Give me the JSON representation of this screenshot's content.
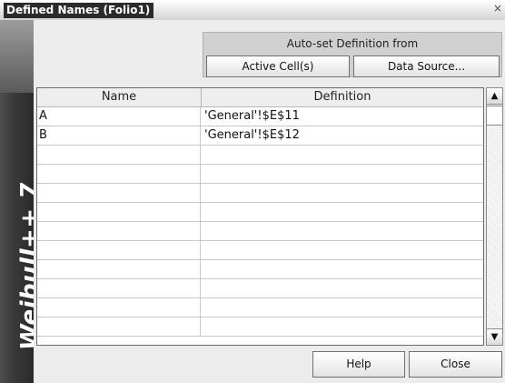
{
  "window": {
    "title": "Defined Names (Folio1)",
    "close_glyph": "×",
    "brand": "Weibull++ 7"
  },
  "autoset": {
    "label": "Auto-set Definition from",
    "active_cells_label": "Active Cell(s)",
    "data_source_label": "Data Source..."
  },
  "table": {
    "columns": [
      "Name",
      "Definition"
    ],
    "rows": [
      {
        "name": "A",
        "definition": "'General'!$E$11"
      },
      {
        "name": "B",
        "definition": "'General'!$E$12"
      },
      {
        "name": "",
        "definition": ""
      },
      {
        "name": "",
        "definition": ""
      },
      {
        "name": "",
        "definition": ""
      },
      {
        "name": "",
        "definition": ""
      },
      {
        "name": "",
        "definition": ""
      },
      {
        "name": "",
        "definition": ""
      },
      {
        "name": "",
        "definition": ""
      },
      {
        "name": "",
        "definition": ""
      },
      {
        "name": "",
        "definition": ""
      },
      {
        "name": "",
        "definition": ""
      }
    ]
  },
  "scrollbar": {
    "up_glyph": "▲",
    "down_glyph": "▼"
  },
  "footer": {
    "help_label": "Help",
    "close_label": "Close"
  }
}
